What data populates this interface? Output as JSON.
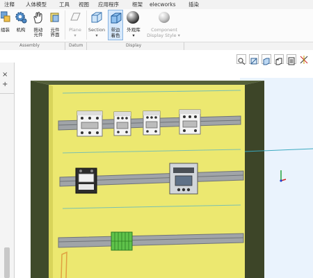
{
  "tabs": [
    "注释",
    "人体模型",
    "工具",
    "视图",
    "应用程序",
    "框架",
    "elecworks",
    "插染"
  ],
  "ribbon": {
    "assemble": "组装",
    "mechanism": "机构",
    "drag": "拖动\n元件",
    "snapshot": "元件\n界面",
    "plane": "Plane",
    "section": "Section",
    "edges_line1": "带边",
    "edges_line2": "着色",
    "appearance": "外观库",
    "component": "Component",
    "component_style": "Display Style"
  },
  "groups": {
    "assembly": "Assembly",
    "datum": "Datum",
    "display": "Display"
  },
  "left_panel": {
    "close": "×",
    "add": "+",
    "arrow": "›"
  },
  "colors": {
    "panel": "#ece870",
    "panel_side": "#d8d45a",
    "cabinet_edge": "#3f4a2a",
    "rail": "#a0a4a8",
    "rail_dark": "#6f7378",
    "viewport": "#eaf3fd"
  }
}
